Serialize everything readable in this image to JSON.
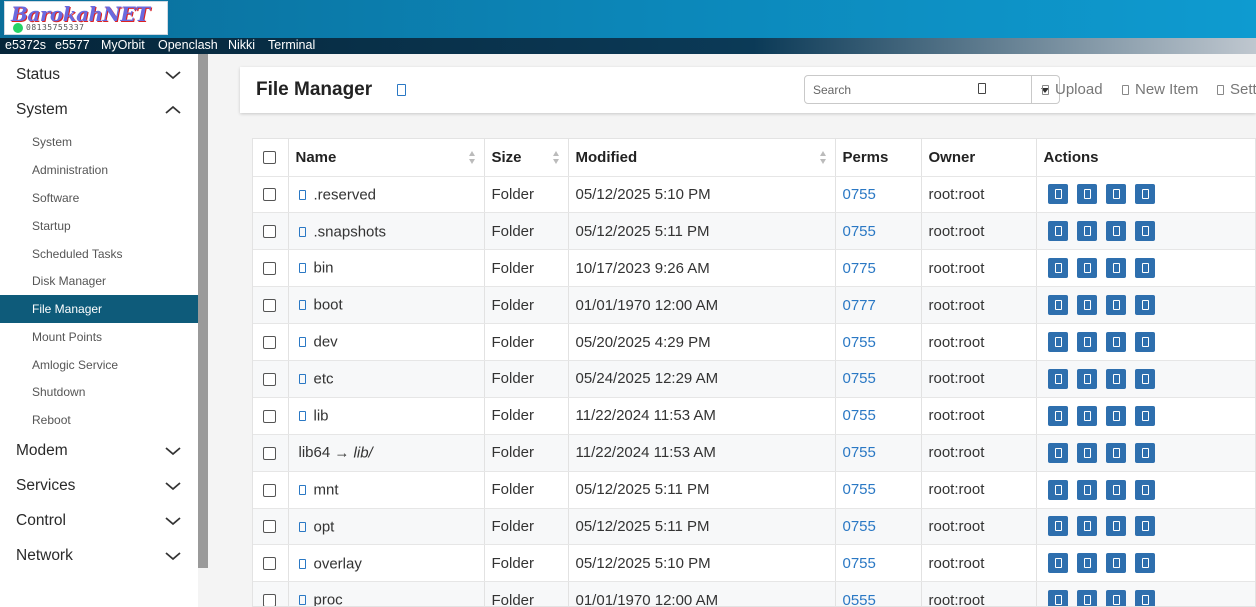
{
  "header": {
    "logo_text": "BarokahNET",
    "logo_phone": "08135755337",
    "quicknav": [
      "e5372s",
      "e5577",
      "MyOrbit",
      "Openclash",
      "Nikki",
      "Terminal"
    ]
  },
  "sidebar": {
    "categories": [
      {
        "label": "Status",
        "expanded": false
      },
      {
        "label": "System",
        "expanded": true
      },
      {
        "label": "Modem",
        "expanded": false
      },
      {
        "label": "Services",
        "expanded": false
      },
      {
        "label": "Control",
        "expanded": false
      },
      {
        "label": "Network",
        "expanded": false
      }
    ],
    "system_items": [
      "System",
      "Administration",
      "Software",
      "Startup",
      "Scheduled Tasks",
      "Disk Manager",
      "File Manager",
      "Mount Points",
      "Amlogic Service",
      "Shutdown",
      "Reboot"
    ],
    "active_item": "File Manager"
  },
  "toolbar": {
    "title": "File Manager",
    "search_placeholder": "Search",
    "upload_label": "Upload",
    "new_item_label": "New Item",
    "settings_label": "Settings"
  },
  "table": {
    "headers": {
      "name": "Name",
      "size": "Size",
      "modified": "Modified",
      "perms": "Perms",
      "owner": "Owner",
      "actions": "Actions"
    },
    "rows": [
      {
        "name": ".reserved",
        "size": "Folder",
        "modified": "05/12/2025 5:10 PM",
        "perms": "0755",
        "owner": "root:root"
      },
      {
        "name": ".snapshots",
        "size": "Folder",
        "modified": "05/12/2025 5:11 PM",
        "perms": "0755",
        "owner": "root:root"
      },
      {
        "name": "bin",
        "size": "Folder",
        "modified": "10/17/2023 9:26 AM",
        "perms": "0775",
        "owner": "root:root"
      },
      {
        "name": "boot",
        "size": "Folder",
        "modified": "01/01/1970 12:00 AM",
        "perms": "0777",
        "owner": "root:root"
      },
      {
        "name": "dev",
        "size": "Folder",
        "modified": "05/20/2025 4:29 PM",
        "perms": "0755",
        "owner": "root:root"
      },
      {
        "name": "etc",
        "size": "Folder",
        "modified": "05/24/2025 12:29 AM",
        "perms": "0755",
        "owner": "root:root"
      },
      {
        "name": "lib",
        "size": "Folder",
        "modified": "11/22/2024 11:53 AM",
        "perms": "0755",
        "owner": "root:root"
      },
      {
        "name": "lib64",
        "link_target": "lib/",
        "size": "Folder",
        "modified": "11/22/2024 11:53 AM",
        "perms": "0755",
        "owner": "root:root"
      },
      {
        "name": "mnt",
        "size": "Folder",
        "modified": "05/12/2025 5:11 PM",
        "perms": "0755",
        "owner": "root:root"
      },
      {
        "name": "opt",
        "size": "Folder",
        "modified": "05/12/2025 5:11 PM",
        "perms": "0755",
        "owner": "root:root"
      },
      {
        "name": "overlay",
        "size": "Folder",
        "modified": "05/12/2025 5:10 PM",
        "perms": "0755",
        "owner": "root:root"
      },
      {
        "name": "proc",
        "size": "Folder",
        "modified": "01/01/1970 12:00 AM",
        "perms": "0555",
        "owner": "root:root"
      }
    ]
  }
}
